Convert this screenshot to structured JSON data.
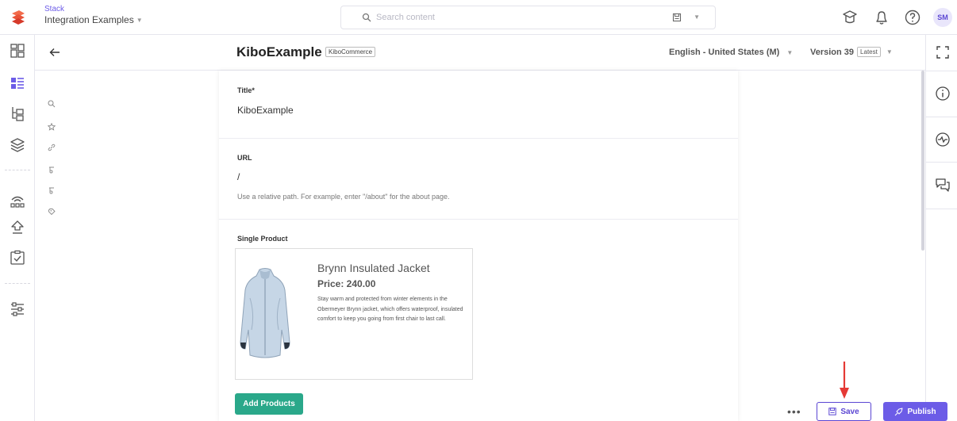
{
  "topbar": {
    "stack_label": "Stack",
    "stack_name": "Integration Examples",
    "search_placeholder": "Search content",
    "avatar_initials": "SM"
  },
  "header": {
    "entry_title": "KiboExample",
    "content_type_badge": "KiboCommerce",
    "locale": "English - United States (M)",
    "version": "Version 39",
    "version_badge": "Latest"
  },
  "fields": {
    "title_label": "Title*",
    "title_value": "KiboExample",
    "url_label": "URL",
    "url_value": "/",
    "url_hint": "Use a relative path. For example, enter \"/about\" for the about page.",
    "product_label": "Single Product"
  },
  "product": {
    "name": "Brynn Insulated Jacket",
    "price": "Price: 240.00",
    "description": "Stay warm and protected from winter elements in the Obermeyer Brynn jacket, which offers waterproof, insulated comfort to keep you going from first chair to last call."
  },
  "actions": {
    "add_products": "Add Products",
    "more": "•••",
    "save": "Save",
    "publish": "Publish"
  },
  "colors": {
    "accent": "#6c5ce7",
    "add_button": "#2aa88a",
    "arrow": "#e53935"
  },
  "icons": {
    "left_nav": [
      "dashboard-icon",
      "entries-icon",
      "content-models-icon",
      "assets-icon",
      "releases-icon",
      "deploy-icon",
      "tasks-icon",
      "settings-icon"
    ],
    "right_panel": [
      "info-icon",
      "activity-icon",
      "comments-icon"
    ],
    "sub_panel": [
      "search-icon",
      "star-icon",
      "link-icon",
      "reference-icon",
      "reference-icon",
      "tag-icon"
    ]
  }
}
